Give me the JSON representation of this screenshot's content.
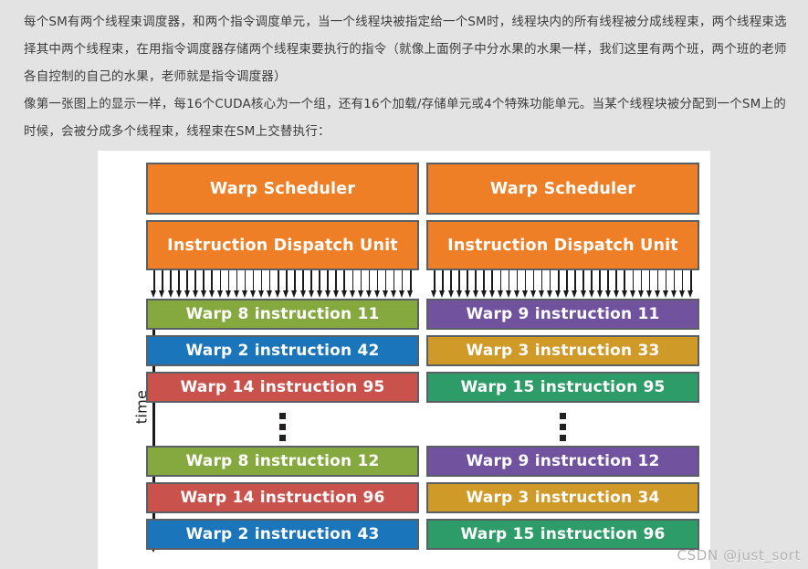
{
  "prose": {
    "paragraph_1": "每个SM有两个线程束调度器，和两个指令调度单元，当一个线程块被指定给一个SM时，线程块内的所有线程被分成线程束，两个线程束选择其中两个线程束，在用指令调度器存储两个线程束要执行的指令（就像上面例子中分水果的水果一样，我们这里有两个班，两个班的老师各自控制的自己的水果，老师就是指令调度器）",
    "paragraph_2": "像第一张图上的显示一样，每16个CUDA核心为一个组，还有16个加载/存储单元或4个特殊功能单元。当某个线程块被分配到一个SM上的时候，会被分成多个线程束，线程束在SM上交替执行："
  },
  "figure": {
    "time_axis_label": "time",
    "ellipsis_symbol": "⋮",
    "arrow_count_per_column": 32,
    "columns": [
      {
        "scheduler_label": "Warp Scheduler",
        "dispatch_label": "Instruction Dispatch Unit",
        "rows_upper": [
          {
            "label": "Warp 8 instruction 11",
            "color": "#86a93f"
          },
          {
            "label": "Warp 2 instruction 42",
            "color": "#1b75bb"
          },
          {
            "label": "Warp 14 instruction 95",
            "color": "#c9524c"
          }
        ],
        "rows_lower": [
          {
            "label": "Warp 8 instruction 12",
            "color": "#86a93f"
          },
          {
            "label": "Warp 14 instruction 96",
            "color": "#c9524c"
          },
          {
            "label": "Warp 2 instruction 43",
            "color": "#1b75bb"
          }
        ]
      },
      {
        "scheduler_label": "Warp Scheduler",
        "dispatch_label": "Instruction Dispatch Unit",
        "rows_upper": [
          {
            "label": "Warp 9 instruction 11",
            "color": "#71529e"
          },
          {
            "label": "Warp 3 instruction 33",
            "color": "#cf9a27"
          },
          {
            "label": "Warp 15 instruction 95",
            "color": "#2d9c69"
          }
        ],
        "rows_lower": [
          {
            "label": "Warp 9 instruction 12",
            "color": "#71529e"
          },
          {
            "label": "Warp 3 instruction 34",
            "color": "#cf9a27"
          },
          {
            "label": "Warp 15 instruction 96",
            "color": "#2d9c69"
          }
        ]
      }
    ]
  },
  "watermark": {
    "text": "CSDN @just_sort"
  },
  "colors": {
    "page_background": "#e3e3e3",
    "figure_background": "#ffffff",
    "header_orange": "#ee7f27",
    "box_border": "#595f63",
    "prose_text": "#3c3c3c",
    "arrow_black": "#1a1a1a",
    "watermark_gray": "#b3b3b3"
  }
}
